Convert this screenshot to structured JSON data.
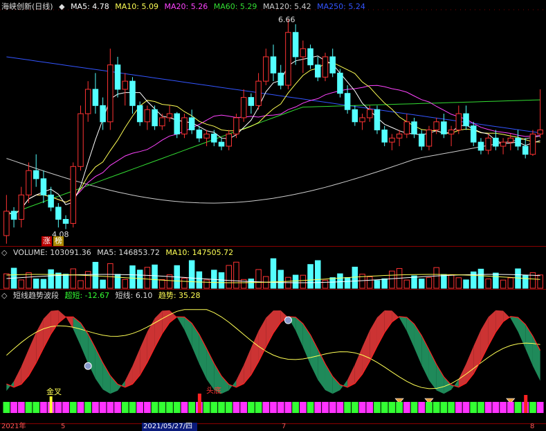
{
  "stock": {
    "name": "海峡创新",
    "period": "(日线)"
  },
  "price_panel": {
    "indicators": [
      {
        "label": "MA5: 4.78",
        "color": "#ffffff"
      },
      {
        "label": "MA10: 5.09",
        "color": "#ffff55"
      },
      {
        "label": "MA20: 5.26",
        "color": "#ff44ff"
      },
      {
        "label": "MA60: 5.29",
        "color": "#33dd33"
      },
      {
        "label": "MA120: 5.42",
        "color": "#cccccc"
      },
      {
        "label": "MA250: 5.24",
        "color": "#3355ff"
      }
    ],
    "high_label": "6.66",
    "low_label": "4.08",
    "badge_chars": [
      "涨",
      "榜"
    ]
  },
  "volume_panel": {
    "label": "VOLUME: 103091.36",
    "ma5": "MA5: 146853.72",
    "ma10": "MA10: 147505.72"
  },
  "indicator_panel": {
    "name": "短线趋势波段",
    "super_short": "超短: -12.67",
    "short": "短线: 6.10",
    "trend": "趋势: 35.28",
    "signal_golden": "金叉",
    "signal_top": "头底"
  },
  "axis": {
    "labels": [
      "2021年",
      "5",
      "2021/05/27/四",
      "7",
      "8"
    ]
  },
  "colors": {
    "up": "#ff3333",
    "down": "#54ffff",
    "ma5": "#ffffff",
    "ma10": "#ffff55",
    "ma20": "#ff44ff",
    "ma60": "#33dd33",
    "ma120": "#cccccc",
    "ma250": "#3355ff",
    "grid": "#8b0000"
  },
  "chart_data": {
    "type": "candlestick",
    "y_range": [
      4.08,
      6.66
    ],
    "candles": [
      [
        4.0,
        4.5,
        3.9,
        4.3
      ],
      [
        4.3,
        4.35,
        4.1,
        4.2
      ],
      [
        4.2,
        4.6,
        4.1,
        4.5
      ],
      [
        4.5,
        4.9,
        4.4,
        4.8
      ],
      [
        4.8,
        5.0,
        4.6,
        4.7
      ],
      [
        4.7,
        4.8,
        4.4,
        4.5
      ],
      [
        4.5,
        4.6,
        4.3,
        4.35
      ],
      [
        4.35,
        4.4,
        4.1,
        4.2
      ],
      [
        4.2,
        4.25,
        4.08,
        4.15
      ],
      [
        4.15,
        4.9,
        4.1,
        4.85
      ],
      [
        4.85,
        5.6,
        4.8,
        5.5
      ],
      [
        5.5,
        5.9,
        5.4,
        5.8
      ],
      [
        5.8,
        6.0,
        5.5,
        5.6
      ],
      [
        5.6,
        5.7,
        5.3,
        5.4
      ],
      [
        5.4,
        6.3,
        5.3,
        6.1
      ],
      [
        6.1,
        6.2,
        5.7,
        5.8
      ],
      [
        5.8,
        6.0,
        5.6,
        5.9
      ],
      [
        5.9,
        5.95,
        5.5,
        5.6
      ],
      [
        5.6,
        5.65,
        5.35,
        5.4
      ],
      [
        5.4,
        5.6,
        5.3,
        5.55
      ],
      [
        5.55,
        5.6,
        5.3,
        5.35
      ],
      [
        5.35,
        5.5,
        5.3,
        5.45
      ],
      [
        5.45,
        5.6,
        5.4,
        5.5
      ],
      [
        5.5,
        5.52,
        5.2,
        5.25
      ],
      [
        5.25,
        5.5,
        5.2,
        5.45
      ],
      [
        5.45,
        5.55,
        5.25,
        5.3
      ],
      [
        5.3,
        5.35,
        5.15,
        5.2
      ],
      [
        5.2,
        5.3,
        5.1,
        5.25
      ],
      [
        5.25,
        5.3,
        5.1,
        5.15
      ],
      [
        5.15,
        5.2,
        5.05,
        5.1
      ],
      [
        5.1,
        5.3,
        5.05,
        5.25
      ],
      [
        5.25,
        5.5,
        5.2,
        5.45
      ],
      [
        5.45,
        5.8,
        5.4,
        5.7
      ],
      [
        5.7,
        5.75,
        5.5,
        5.6
      ],
      [
        5.6,
        6.0,
        5.55,
        5.9
      ],
      [
        5.9,
        6.3,
        5.85,
        6.2
      ],
      [
        6.2,
        6.35,
        5.9,
        6.0
      ],
      [
        6.0,
        6.1,
        5.8,
        5.85
      ],
      [
        5.85,
        6.66,
        5.8,
        6.5
      ],
      [
        6.5,
        6.6,
        6.1,
        6.2
      ],
      [
        6.2,
        6.4,
        6.0,
        6.3
      ],
      [
        6.3,
        6.35,
        6.05,
        6.1
      ],
      [
        6.1,
        6.2,
        5.9,
        5.95
      ],
      [
        5.95,
        6.25,
        5.9,
        6.2
      ],
      [
        6.2,
        6.3,
        5.95,
        6.0
      ],
      [
        6.0,
        6.05,
        5.7,
        5.75
      ],
      [
        5.75,
        5.85,
        5.5,
        5.55
      ],
      [
        5.55,
        5.6,
        5.35,
        5.4
      ],
      [
        5.4,
        5.5,
        5.3,
        5.45
      ],
      [
        5.45,
        5.6,
        5.4,
        5.55
      ],
      [
        5.55,
        5.6,
        5.25,
        5.3
      ],
      [
        5.3,
        5.35,
        5.1,
        5.15
      ],
      [
        5.15,
        5.25,
        5.05,
        5.2
      ],
      [
        5.2,
        5.3,
        5.1,
        5.25
      ],
      [
        5.25,
        5.5,
        5.2,
        5.4
      ],
      [
        5.4,
        5.45,
        5.2,
        5.25
      ],
      [
        5.25,
        5.3,
        5.05,
        5.1
      ],
      [
        5.1,
        5.35,
        5.05,
        5.3
      ],
      [
        5.3,
        5.45,
        5.25,
        5.4
      ],
      [
        5.4,
        5.5,
        5.2,
        5.25
      ],
      [
        5.25,
        5.35,
        5.1,
        5.3
      ],
      [
        5.3,
        5.6,
        5.25,
        5.5
      ],
      [
        5.5,
        5.6,
        5.3,
        5.35
      ],
      [
        5.35,
        5.4,
        5.1,
        5.15
      ],
      [
        5.15,
        5.2,
        5.0,
        5.05
      ],
      [
        5.05,
        5.25,
        5.0,
        5.2
      ],
      [
        5.2,
        5.3,
        5.05,
        5.1
      ],
      [
        5.1,
        5.2,
        5.0,
        5.15
      ],
      [
        5.15,
        5.25,
        5.05,
        5.2
      ],
      [
        5.2,
        5.3,
        5.05,
        5.1
      ],
      [
        5.1,
        5.2,
        4.95,
        5.0
      ],
      [
        5.0,
        5.3,
        4.98,
        5.25
      ],
      [
        5.25,
        5.8,
        5.2,
        5.3
      ]
    ]
  }
}
